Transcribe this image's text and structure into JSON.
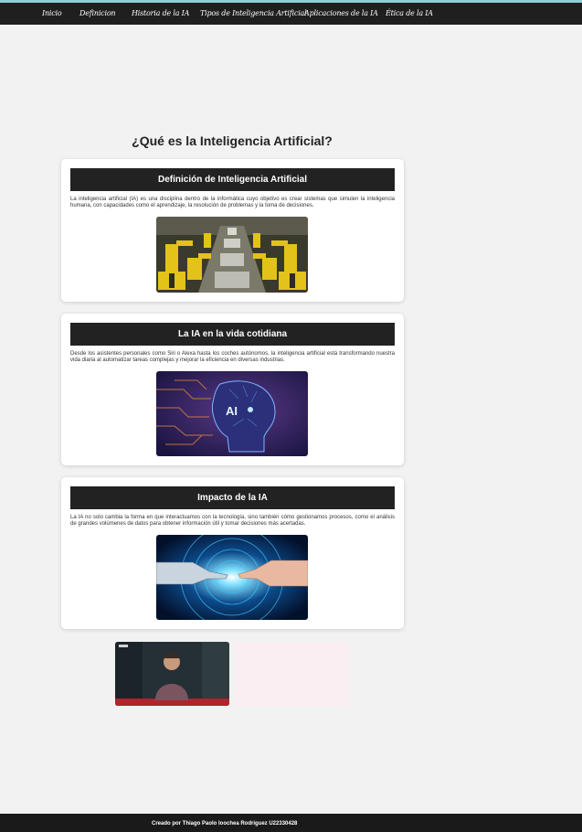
{
  "nav": {
    "items": [
      {
        "label": "Inicio"
      },
      {
        "label": "Definicion"
      },
      {
        "label": "Historia de la IA"
      },
      {
        "label": "Tipos de Inteligencia Artificial"
      },
      {
        "label": "Aplicaciones de la IA"
      },
      {
        "label": "Ética de la IA"
      }
    ]
  },
  "main": {
    "title": "¿Qué es la Inteligencia Artificial?",
    "cards": [
      {
        "title": "Definición de Inteligencia Artificial",
        "text": "La inteligencia artificial (IA) es una disciplina dentro de la informática cuyo objetivo es crear sistemas que simulen la inteligencia humana, con capacidades como el aprendizaje, la resolución de problemas y la toma de decisiones.",
        "image": "robotic-assembly-line"
      },
      {
        "title": "La IA en la vida cotidiana",
        "text": "Desde los asistentes personales como Siri o Alexa hasta los coches autónomos, la inteligencia artificial está transformando nuestra vida diaria al automatizar tareas complejas y mejorar la eficiencia en diversas industrias.",
        "image": "ai-head-circuit",
        "image_label": "AI"
      },
      {
        "title": "Impacto de la IA",
        "text": "La IA no solo cambia la forma en que interactuamos con la tecnología, sino también cómo gestionamos procesos, como el análisis de grandes volúmenes de datos para obtener información útil y tomar decisiones más acertadas.",
        "image": "robot-human-hands"
      }
    ],
    "videos": [
      {
        "name": "presenter-video"
      },
      {
        "name": "blank-video"
      }
    ]
  },
  "footer": {
    "text": "Creado por Thiago Paolo Ioochea Rodriguez U22330428"
  },
  "colors": {
    "nav_bg": "#1f1f1f",
    "page_bg": "#f2f2f2",
    "card_header_bg": "#222222",
    "footer_bg": "#1a1a1a",
    "accent_line": "#8fd0d6"
  }
}
